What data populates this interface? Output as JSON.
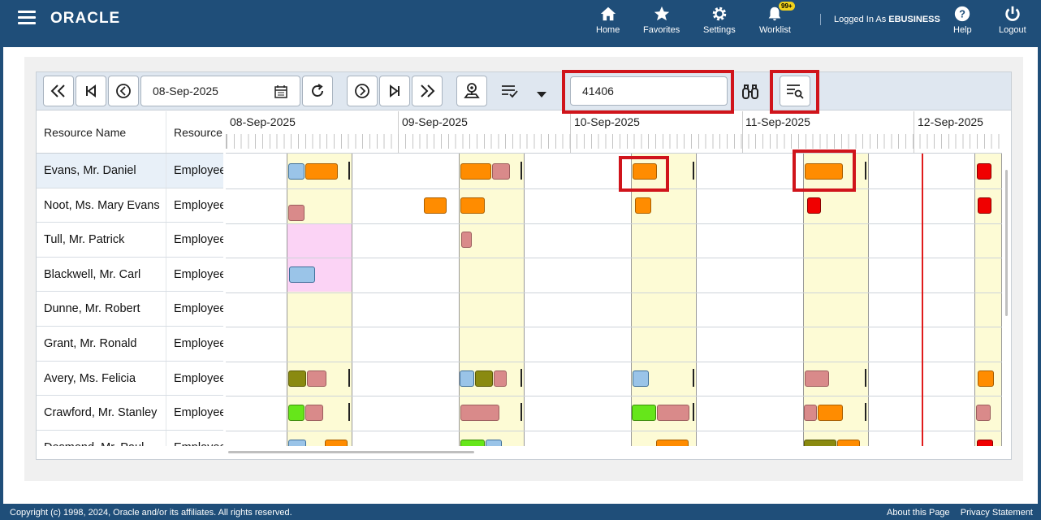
{
  "header": {
    "logo": "ORACLE",
    "nav": [
      {
        "label": "Home",
        "icon": "home-icon"
      },
      {
        "label": "Favorites",
        "icon": "star-icon"
      },
      {
        "label": "Settings",
        "icon": "gear-icon"
      },
      {
        "label": "Worklist",
        "icon": "bell-icon",
        "badge": "99+"
      }
    ],
    "logged_prefix": "Logged In As ",
    "logged_user": "EBUSINESS",
    "help": "Help",
    "logout": "Logout"
  },
  "toolbar": {
    "date": "08-Sep-2025",
    "search_value": "41406"
  },
  "grid": {
    "col_resource_name": "Resource Name",
    "col_resource_type": "Resource",
    "dates": [
      "08-Sep-2025",
      "09-Sep-2025",
      "10-Sep-2025",
      "11-Sep-2025",
      "12-Sep-2025"
    ],
    "rows": [
      {
        "name": "Evans, Mr. Daniel",
        "type": "Employee"
      },
      {
        "name": "Noot, Ms. Mary Evans",
        "type": "Employee"
      },
      {
        "name": "Tull, Mr. Patrick",
        "type": "Employee"
      },
      {
        "name": "Blackwell, Mr. Carl",
        "type": "Employee"
      },
      {
        "name": "Dunne, Mr. Robert",
        "type": "Employee"
      },
      {
        "name": "Grant, Mr. Ronald",
        "type": "Employee"
      },
      {
        "name": "Avery, Ms. Felicia",
        "type": "Employee"
      },
      {
        "name": "Crawford, Mr. Stanley",
        "type": "Employee"
      },
      {
        "name": "Desmond, Mr. Paul",
        "type": "Employee"
      }
    ]
  },
  "colors": {
    "header": "#1f4e79",
    "highlight": "#d0141b",
    "orange": "#ff8c00"
  },
  "footer": {
    "copyright": "Copyright (c) 1998, 2024, Oracle and/or its affiliates. All rights reserved.",
    "about": "About this Page",
    "privacy": "Privacy Statement"
  }
}
